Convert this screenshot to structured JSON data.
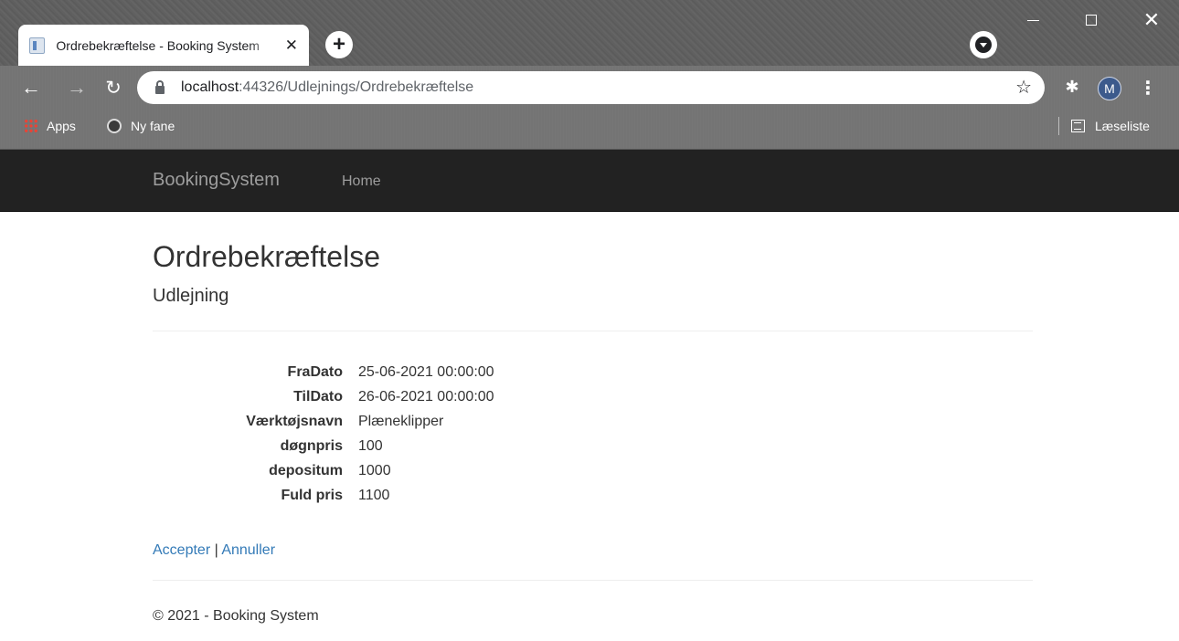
{
  "browser": {
    "tab_title": "Ordrebekræftelse - Booking System",
    "tab_close": "✕",
    "new_tab": "+",
    "url_host": "localhost",
    "url_path": ":44326/Udlejnings/Ordrebekræftelse",
    "avatar_initial": "M",
    "bookmarks": [
      {
        "label": "Apps"
      },
      {
        "label": "Ny fane"
      }
    ],
    "reading_list": "Læseliste"
  },
  "navbar": {
    "brand": "BookingSystem",
    "links": [
      {
        "label": "Home"
      }
    ]
  },
  "page": {
    "title": "Ordrebekræftelse",
    "subtitle": "Udlejning",
    "details": [
      {
        "label": "FraDato",
        "value": "25-06-2021 00:00:00"
      },
      {
        "label": "TilDato",
        "value": "26-06-2021 00:00:00"
      },
      {
        "label": "Værktøjsnavn",
        "value": "Plæneklipper"
      },
      {
        "label": "døgnpris",
        "value": "100"
      },
      {
        "label": "depositum",
        "value": "1000"
      },
      {
        "label": "Fuld pris",
        "value": "1100"
      }
    ],
    "actions": {
      "accept": "Accepter",
      "separator": " | ",
      "cancel": "Annuller"
    },
    "footer": "© 2021 - Booking System"
  }
}
